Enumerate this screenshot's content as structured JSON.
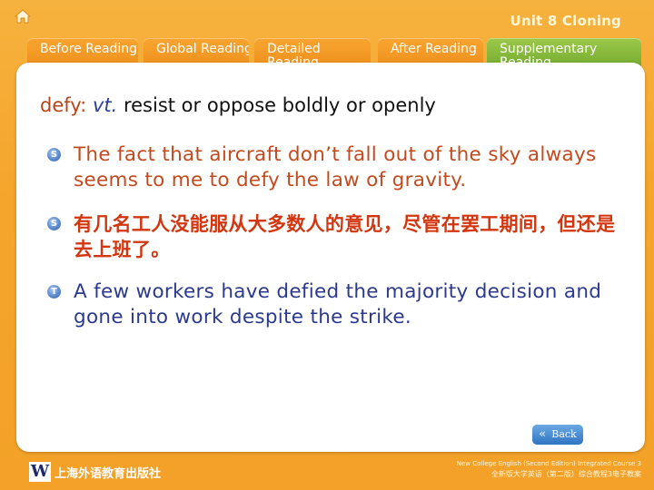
{
  "header": {
    "unit_title": "Unit 8 Cloning"
  },
  "tabs": [
    {
      "label": "Before Reading"
    },
    {
      "label": "Global Reading"
    },
    {
      "label": "Detailed Reading"
    },
    {
      "label": "After Reading"
    },
    {
      "label": "Supplementary Reading"
    }
  ],
  "definition": {
    "word": "defy:",
    "pos": "vt.",
    "meaning": "resist or oppose boldly or openly"
  },
  "examples": [
    {
      "bullet": "S",
      "text": "The fact that aircraft don’t fall out of the sky always seems to me to defy the law of gravity."
    },
    {
      "bullet": "S",
      "text": "有几名工人没能服从大多数人的意见，尽管在罢工期间，但还是去上班了。"
    },
    {
      "bullet": "T",
      "text": "A few workers have defied the majority decision and gone into work despite the strike."
    }
  ],
  "back_button": {
    "label": "Back"
  },
  "footer": {
    "publisher": "上海外语教育出版社",
    "course_en": "New College English (Second Edition) Integrated Course 3",
    "course_cn": "全新版大学英语（第二版）综合教程3电子教案"
  },
  "colors": {
    "background": "#f5a52c",
    "tab_orange": "#ec8b17",
    "tab_green": "#6da52a",
    "definition_word": "#b8441a",
    "example_en_red": "#c24a1e",
    "example_cn": "#d3360f",
    "example_en_blue": "#2b3a8f"
  }
}
